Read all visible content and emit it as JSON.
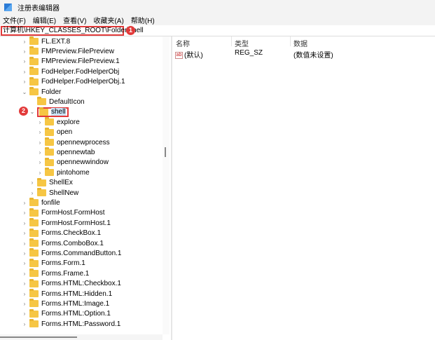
{
  "window": {
    "title": "注册表编辑器"
  },
  "menu": [
    "文件(F)",
    "编辑(E)",
    "查看(V)",
    "收藏夹(A)",
    "帮助(H)"
  ],
  "address": {
    "path": "计算机\\HKEY_CLASSES_ROOT\\Folder\\shell",
    "badge": "1"
  },
  "selection_badge": "2",
  "tree": [
    {
      "label": "FL.EXT.8",
      "level": 0,
      "expander": ">"
    },
    {
      "label": "FMPreview.FilePreview",
      "level": 0,
      "expander": ">"
    },
    {
      "label": "FMPreview.FilePreview.1",
      "level": 0,
      "expander": ">"
    },
    {
      "label": "FodHelper.FodHelperObj",
      "level": 0,
      "expander": ">"
    },
    {
      "label": "FodHelper.FodHelperObj.1",
      "level": 0,
      "expander": ">"
    },
    {
      "label": "Folder",
      "level": 0,
      "expander": "v"
    },
    {
      "label": "DefaultIcon",
      "level": 1,
      "expander": ""
    },
    {
      "label": "shell",
      "level": 1,
      "expander": "v",
      "selected": true
    },
    {
      "label": "explore",
      "level": 2,
      "expander": ">"
    },
    {
      "label": "open",
      "level": 2,
      "expander": ">"
    },
    {
      "label": "opennewprocess",
      "level": 2,
      "expander": ">"
    },
    {
      "label": "opennewtab",
      "level": 2,
      "expander": ">"
    },
    {
      "label": "opennewwindow",
      "level": 2,
      "expander": ">"
    },
    {
      "label": "pintohome",
      "level": 2,
      "expander": ">"
    },
    {
      "label": "ShellEx",
      "level": 1,
      "expander": ">"
    },
    {
      "label": "ShellNew",
      "level": 1,
      "expander": ">"
    },
    {
      "label": "fonfile",
      "level": 0,
      "expander": ">"
    },
    {
      "label": "FormHost.FormHost",
      "level": 0,
      "expander": ">"
    },
    {
      "label": "FormHost.FormHost.1",
      "level": 0,
      "expander": ">"
    },
    {
      "label": "Forms.CheckBox.1",
      "level": 0,
      "expander": ">"
    },
    {
      "label": "Forms.ComboBox.1",
      "level": 0,
      "expander": ">"
    },
    {
      "label": "Forms.CommandButton.1",
      "level": 0,
      "expander": ">"
    },
    {
      "label": "Forms.Form.1",
      "level": 0,
      "expander": ">"
    },
    {
      "label": "Forms.Frame.1",
      "level": 0,
      "expander": ">"
    },
    {
      "label": "Forms.HTML:Checkbox.1",
      "level": 0,
      "expander": ">"
    },
    {
      "label": "Forms.HTML:Hidden.1",
      "level": 0,
      "expander": ">"
    },
    {
      "label": "Forms.HTML:Image.1",
      "level": 0,
      "expander": ">"
    },
    {
      "label": "Forms.HTML:Option.1",
      "level": 0,
      "expander": ">"
    },
    {
      "label": "Forms.HTML:Password.1",
      "level": 0,
      "expander": ">"
    }
  ],
  "values": {
    "columns": [
      "名称",
      "类型",
      "数据"
    ],
    "rows": [
      {
        "name": "(默认)",
        "type": "REG_SZ",
        "data": "(数值未设置)",
        "icon": "ab"
      }
    ]
  }
}
